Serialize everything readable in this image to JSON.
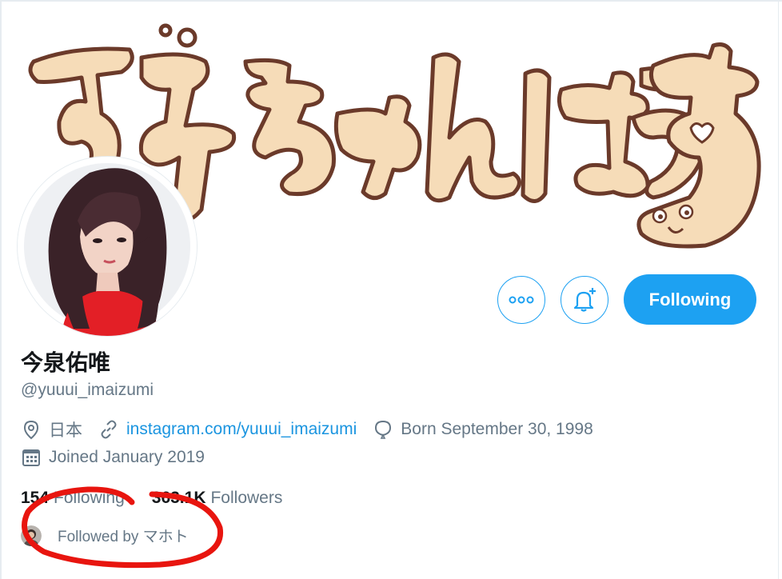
{
  "banner": {
    "title_image": "ずみちゃんはうす"
  },
  "actions": {
    "more_icon": "more-dots-icon",
    "notify_icon": "bell-plus-icon",
    "follow_label": "Following"
  },
  "profile": {
    "name": "今泉佑唯",
    "handle": "@yuuui_imaizumi",
    "location": "日本",
    "url": "instagram.com/yuuui_imaizumi",
    "birthday": "Born September 30, 1998",
    "joined": "Joined January 2019"
  },
  "stats": {
    "following_count": "154",
    "following_label": "Following",
    "followers_count": "363.1K",
    "followers_label": "Followers"
  },
  "followed_by": {
    "text": "Followed by マホト"
  },
  "colors": {
    "accent": "#1da1f2",
    "muted": "#657786",
    "annotation": "#e8150f",
    "banner_fill": "#f6dcb8",
    "banner_stroke": "#6b3a2a"
  }
}
